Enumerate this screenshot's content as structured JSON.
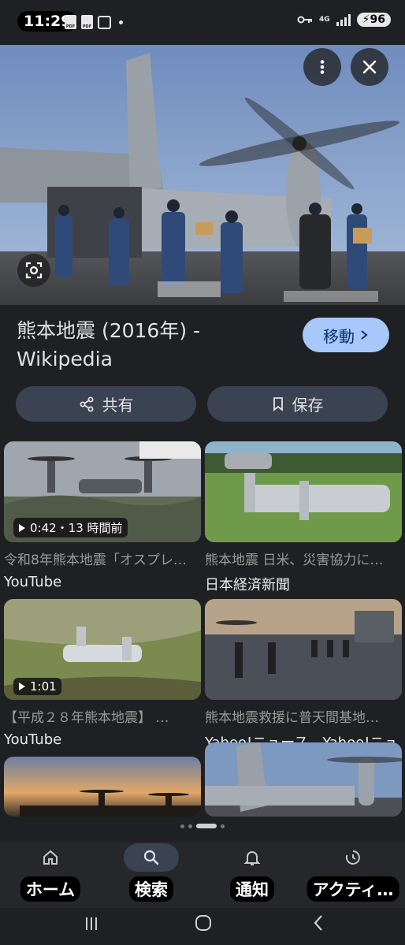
{
  "status_bar": {
    "time": "11:29",
    "network": "4G",
    "battery": "96"
  },
  "result": {
    "title": "熊本地震 (2016年) - Wikipedia",
    "visit_label": "移動",
    "share_label": "共有",
    "save_label": "保存"
  },
  "related": [
    {
      "title": "令和8年熊本地震「オスプレイ…",
      "source": "YouTube",
      "duration": "0:42・13 時間前"
    },
    {
      "title": "熊本地震 日米、災害協力に…",
      "source": "日本経済新聞",
      "duration": ""
    },
    {
      "title": "【平成２８年熊本地震】 …",
      "source": "YouTube",
      "duration": "1:01"
    },
    {
      "title": "熊本地震救援に普天間基地…",
      "source": "Yahoo!ニュース - Yahoo!ニュース",
      "duration": ""
    },
    {
      "title": "",
      "source": "",
      "duration": ""
    },
    {
      "title": "",
      "source": "",
      "duration": ""
    }
  ],
  "bottom_nav": [
    {
      "label": "ホーム",
      "icon": "home-icon"
    },
    {
      "label": "検索",
      "icon": "search-icon"
    },
    {
      "label": "通知",
      "icon": "bell-icon"
    },
    {
      "label": "アクティ…",
      "icon": "activity-icon"
    }
  ],
  "colors": {
    "background": "#1f2023",
    "accent_button": "#a8c7fa",
    "pill_button": "#3b4252",
    "nav_active": "#3b4252"
  }
}
